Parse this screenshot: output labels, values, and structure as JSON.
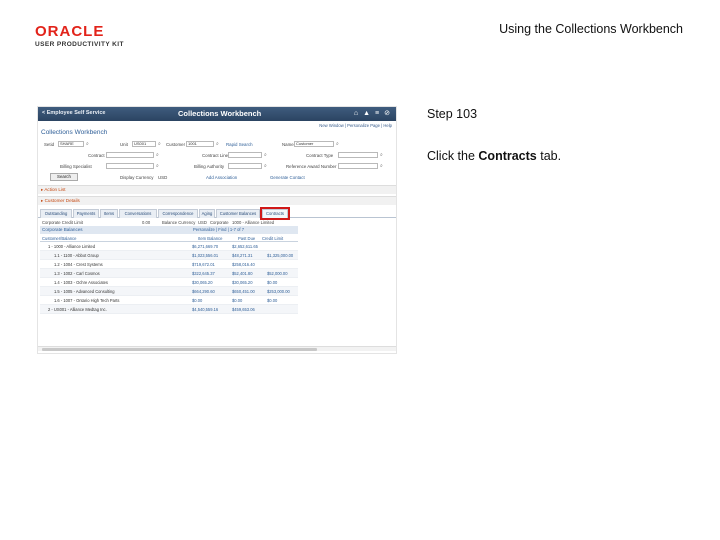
{
  "slide": {
    "logo_brand": "ORACLE",
    "logo_sub": "USER PRODUCTIVITY KIT",
    "title": "Using the Collections Workbench",
    "step": "Step 103",
    "instruction_prefix": "Click the ",
    "instruction_target": "Contracts",
    "instruction_suffix": " tab."
  },
  "app": {
    "back_link": "< Employee Self Service",
    "title": "Collections Workbench",
    "top_links": "New Window | Personalize Page | Help",
    "page_title": "Collections Workbench",
    "header_icons": [
      "home-icon",
      "bell-icon",
      "menu-icon",
      "compass-icon"
    ]
  },
  "search": {
    "row1": {
      "label1": "Setid",
      "value1": "SHARE",
      "label2": "Unit",
      "value2": "US001",
      "label3": "Customer",
      "value3": "1001",
      "link": "Rapid Search",
      "label4": "Name",
      "value4": "Customer"
    },
    "row2": {
      "label1": "Contract",
      "label2": "Contract Line",
      "label3": "Contract Type"
    },
    "row3": {
      "label1": "Billing Specialist",
      "label2": "Billing Authority",
      "label3": "Reference Award Number"
    },
    "search_button": "Search",
    "display_currency_label": "Display Currency",
    "display_currency_value": "USD",
    "add_association": "Add Association",
    "generate_contact": "Generate Contact"
  },
  "sections": {
    "action_list": "Action List",
    "customer_details": "Customer Details"
  },
  "tabs": [
    "Outstanding",
    "Payments",
    "Items",
    "Conversations",
    "Correspondence",
    "Aging",
    "Customer Balances",
    "Contracts"
  ],
  "highlighted_tab": "Contracts",
  "info": {
    "credit_limit_label": "Corporate Credit Limit",
    "credit_limit_value": "0.00",
    "balance_label": "Balance Currency",
    "balance_value": "USD",
    "corporate_label": "Corporate",
    "corporate_value": "1000 - Alliance Limited"
  },
  "grid": {
    "title": "Corporate Balances",
    "nav": "Personalize | Find | 1-7 of 7",
    "columns": [
      "Customer/Balance",
      "Item Balance",
      "Past Due",
      "Credit Limit"
    ],
    "rows": [
      {
        "name": "1 - 1000 - Alliance Limited",
        "item": "$6,271,669.70",
        "past": "$2,652,611.65",
        "limit": ""
      },
      {
        "name": "1.1 - 1100 - Abbot Group",
        "item": "$1,023,556.01",
        "past": "$48,271.31",
        "limit": "$1,325,000.00"
      },
      {
        "name": "1.2 - 1004 - Crest Systems",
        "item": "$719,672.01",
        "past": "$258,016.40",
        "limit": ""
      },
      {
        "name": "1.3 - 1002 - Carl Cosmos",
        "item": "$322,645.37",
        "past": "$52,401.80",
        "limit": "$52,000.00"
      },
      {
        "name": "1.4 - 1003 - Ochre Associates",
        "item": "$30,065.20",
        "past": "$30,065.20",
        "limit": "$0.00"
      },
      {
        "name": "1.5 - 1005 - Advanced Consulting",
        "item": "$664,290.60",
        "past": "$650,451.00",
        "limit": "$253,000.00"
      },
      {
        "name": "1.6 - 1007 - Ontario High Tech Parts",
        "item": "$0.00",
        "past": "$0.00",
        "limit": "$0.00"
      },
      {
        "name": "2 - US001 - Alliance Medtag Inc.",
        "item": "$4,540,559.16",
        "past": "$459,653.06",
        "limit": ""
      }
    ]
  }
}
